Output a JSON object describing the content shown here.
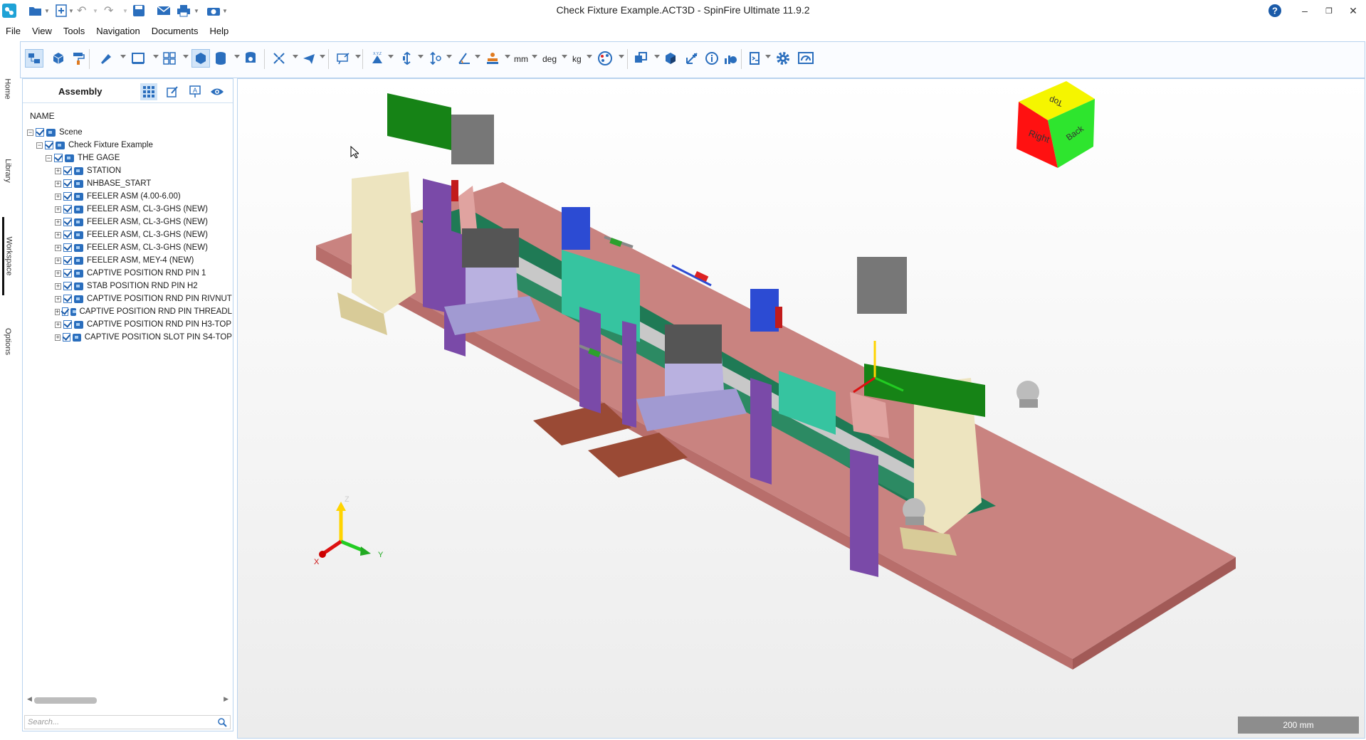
{
  "window": {
    "title": "Check Fixture Example.ACT3D - SpinFire Ultimate 11.9.2"
  },
  "menu": [
    "File",
    "View",
    "Tools",
    "Navigation",
    "Documents",
    "Help"
  ],
  "toolbar": {
    "units": {
      "length": "mm",
      "angle": "deg",
      "mass": "kg"
    }
  },
  "side_tabs": [
    "Home",
    "Library",
    "Workspace",
    "Options"
  ],
  "assembly": {
    "title": "Assembly",
    "column_header": "NAME",
    "search_placeholder": "Search...",
    "tree": [
      {
        "label": "Scene",
        "level": 0
      },
      {
        "label": "Check Fixture Example",
        "level": 1
      },
      {
        "label": "THE GAGE",
        "level": 2
      },
      {
        "label": "STATION",
        "level": 3
      },
      {
        "label": "NHBASE_START",
        "level": 3
      },
      {
        "label": "FEELER ASM (4.00-6.00)",
        "level": 3
      },
      {
        "label": "FEELER ASM, CL-3-GHS (NEW)",
        "level": 3
      },
      {
        "label": "FEELER ASM, CL-3-GHS (NEW)",
        "level": 3
      },
      {
        "label": "FEELER ASM, CL-3-GHS (NEW)",
        "level": 3
      },
      {
        "label": "FEELER ASM, CL-3-GHS (NEW)",
        "level": 3
      },
      {
        "label": "FEELER ASM, MEY-4 (NEW)",
        "level": 3
      },
      {
        "label": "CAPTIVE POSITION RND PIN 1",
        "level": 3
      },
      {
        "label": "STAB POSITION RND PIN H2",
        "level": 3
      },
      {
        "label": "CAPTIVE POSITION RND PIN RIVNUT",
        "level": 3
      },
      {
        "label": "CAPTIVE POSITION RND PIN THREADL",
        "level": 3
      },
      {
        "label": "CAPTIVE POSITION RND PIN H3-TOP",
        "level": 3
      },
      {
        "label": "CAPTIVE POSITION SLOT PIN S4-TOP",
        "level": 3
      }
    ]
  },
  "viewport": {
    "view_cube": {
      "top": "Top",
      "right": "Right",
      "back": "Back"
    },
    "triad": {
      "x": "X",
      "y": "Y",
      "z": "Z"
    },
    "scale_bar": "200 mm"
  },
  "colors": {
    "accent": "#2a6ebd",
    "base_plate": "#c98380",
    "frame": "#b9d3ee"
  }
}
